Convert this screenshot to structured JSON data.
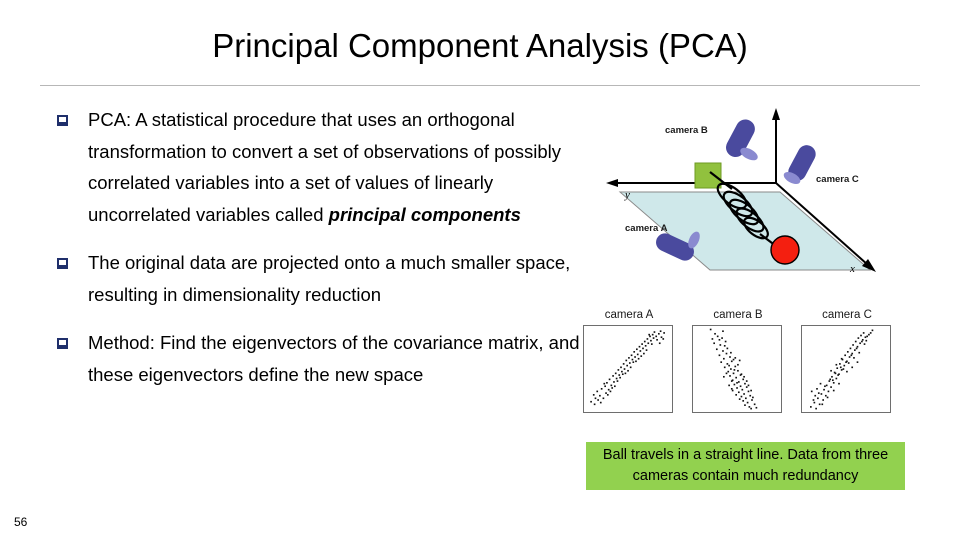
{
  "slide": {
    "title": "Principal Component Analysis (PCA)",
    "page_number": "56"
  },
  "bullets": [
    {
      "marker": "❑",
      "text_before": "PCA:  A statistical procedure that uses an orthogonal transformation to convert a set of observations of possibly correlated variables into a set of values of linearly uncorrelated variables called ",
      "emphasis": "principal components",
      "text_after": ""
    },
    {
      "marker": "❑",
      "text_before": "The original data are projected onto a much smaller space, resulting in dimensionality reduction",
      "emphasis": "",
      "text_after": ""
    },
    {
      "marker": "❑",
      "text_before": "Method:  Find the eigenvectors of the covariance matrix, and these eigenvectors define the new space",
      "emphasis": "",
      "text_after": ""
    }
  ],
  "figure_3d": {
    "axis_x_label": "x",
    "axis_y_label": "y",
    "camera_a_label": "camera A",
    "camera_b_label": "camera B",
    "camera_c_label": "camera C",
    "colors": {
      "plane": "#cfe8ea",
      "plane_edge": "#808080",
      "camera_body": "#4a4a9e",
      "camera_lens": "#8a8ad0",
      "wall_mount": "#91c13e",
      "ball": "#f41f10",
      "spring": "#000000",
      "axis": "#000000"
    }
  },
  "camera_panels": [
    {
      "label": "camera A",
      "chart_data": {
        "type": "scatter",
        "title": "camera A",
        "xlabel": "",
        "ylabel": "",
        "xlim": [
          0,
          100
        ],
        "ylim": [
          0,
          100
        ],
        "grid": false,
        "points": [
          [
            8,
            12
          ],
          [
            12,
            9
          ],
          [
            16,
            14
          ],
          [
            11,
            20
          ],
          [
            18,
            19
          ],
          [
            22,
            16
          ],
          [
            15,
            24
          ],
          [
            20,
            27
          ],
          [
            25,
            22
          ],
          [
            24,
            30
          ],
          [
            28,
            26
          ],
          [
            26,
            34
          ],
          [
            31,
            31
          ],
          [
            29,
            38
          ],
          [
            34,
            35
          ],
          [
            33,
            42
          ],
          [
            37,
            39
          ],
          [
            36,
            45
          ],
          [
            40,
            43
          ],
          [
            39,
            49
          ],
          [
            43,
            47
          ],
          [
            42,
            52
          ],
          [
            46,
            50
          ],
          [
            45,
            56
          ],
          [
            49,
            54
          ],
          [
            48,
            60
          ],
          [
            52,
            57
          ],
          [
            51,
            63
          ],
          [
            55,
            61
          ],
          [
            54,
            66
          ],
          [
            58,
            64
          ],
          [
            57,
            70
          ],
          [
            61,
            67
          ],
          [
            60,
            73
          ],
          [
            64,
            71
          ],
          [
            63,
            76
          ],
          [
            67,
            74
          ],
          [
            66,
            79
          ],
          [
            70,
            77
          ],
          [
            69,
            82
          ],
          [
            73,
            80
          ],
          [
            72,
            85
          ],
          [
            76,
            83
          ],
          [
            75,
            88
          ],
          [
            79,
            86
          ],
          [
            78,
            90
          ],
          [
            82,
            88
          ],
          [
            85,
            91
          ],
          [
            88,
            87
          ],
          [
            91,
            92
          ],
          [
            38,
            36
          ],
          [
            44,
            44
          ],
          [
            50,
            48
          ],
          [
            56,
            58
          ],
          [
            62,
            62
          ],
          [
            68,
            68
          ],
          [
            30,
            24
          ],
          [
            35,
            30
          ],
          [
            41,
            40
          ],
          [
            47,
            45
          ],
          [
            53,
            52
          ],
          [
            59,
            59
          ],
          [
            65,
            65
          ],
          [
            71,
            72
          ],
          [
            77,
            79
          ],
          [
            83,
            84
          ],
          [
            86,
            80
          ],
          [
            13,
            16
          ],
          [
            19,
            11
          ],
          [
            23,
            33
          ],
          [
            27,
            20
          ],
          [
            32,
            28
          ],
          [
            80,
            93
          ],
          [
            74,
            90
          ],
          [
            87,
            94
          ],
          [
            90,
            85
          ]
        ]
      }
    },
    {
      "label": "camera B",
      "chart_data": {
        "type": "scatter",
        "title": "camera B",
        "xlabel": "",
        "ylabel": "",
        "xlim": [
          0,
          100
        ],
        "ylim": [
          0,
          100
        ],
        "grid": false,
        "points": [
          [
            20,
            96
          ],
          [
            28,
            88
          ],
          [
            33,
            86
          ],
          [
            24,
            80
          ],
          [
            31,
            78
          ],
          [
            37,
            82
          ],
          [
            27,
            73
          ],
          [
            34,
            71
          ],
          [
            30,
            66
          ],
          [
            38,
            68
          ],
          [
            35,
            62
          ],
          [
            42,
            64
          ],
          [
            32,
            58
          ],
          [
            39,
            56
          ],
          [
            44,
            59
          ],
          [
            36,
            52
          ],
          [
            43,
            50
          ],
          [
            48,
            53
          ],
          [
            40,
            47
          ],
          [
            46,
            45
          ],
          [
            51,
            48
          ],
          [
            42,
            42
          ],
          [
            49,
            40
          ],
          [
            54,
            43
          ],
          [
            45,
            37
          ],
          [
            52,
            35
          ],
          [
            57,
            38
          ],
          [
            47,
            32
          ],
          [
            54,
            30
          ],
          [
            59,
            33
          ],
          [
            50,
            28
          ],
          [
            56,
            26
          ],
          [
            61,
            29
          ],
          [
            52,
            23
          ],
          [
            58,
            21
          ],
          [
            63,
            24
          ],
          [
            55,
            18
          ],
          [
            60,
            16
          ],
          [
            65,
            19
          ],
          [
            57,
            13
          ],
          [
            62,
            11
          ],
          [
            67,
            14
          ],
          [
            59,
            8
          ],
          [
            64,
            6
          ],
          [
            70,
            9
          ],
          [
            66,
            4
          ],
          [
            72,
            5
          ],
          [
            41,
            54
          ],
          [
            47,
            49
          ],
          [
            44,
            36
          ],
          [
            50,
            34
          ],
          [
            53,
            60
          ],
          [
            46,
            61
          ],
          [
            39,
            74
          ],
          [
            36,
            77
          ],
          [
            43,
            69
          ],
          [
            48,
            63
          ],
          [
            51,
            55
          ],
          [
            55,
            44
          ],
          [
            58,
            41
          ],
          [
            61,
            36
          ],
          [
            63,
            31
          ],
          [
            66,
            25
          ],
          [
            68,
            17
          ],
          [
            45,
            25
          ],
          [
            49,
            20
          ],
          [
            53,
            15
          ],
          [
            38,
            45
          ],
          [
            35,
            41
          ],
          [
            41,
            31
          ],
          [
            44,
            27
          ],
          [
            30,
            84
          ],
          [
            25,
            91
          ],
          [
            22,
            85
          ],
          [
            34,
            94
          ]
        ]
      }
    },
    {
      "label": "camera C",
      "chart_data": {
        "type": "scatter",
        "title": "camera C",
        "xlabel": "",
        "ylabel": "",
        "xlim": [
          0,
          100
        ],
        "ylim": [
          0,
          100
        ],
        "grid": false,
        "points": [
          [
            10,
            6
          ],
          [
            16,
            4
          ],
          [
            14,
            11
          ],
          [
            20,
            9
          ],
          [
            18,
            16
          ],
          [
            24,
            14
          ],
          [
            22,
            21
          ],
          [
            27,
            19
          ],
          [
            25,
            26
          ],
          [
            30,
            24
          ],
          [
            28,
            31
          ],
          [
            33,
            29
          ],
          [
            31,
            36
          ],
          [
            36,
            34
          ],
          [
            34,
            41
          ],
          [
            39,
            39
          ],
          [
            37,
            46
          ],
          [
            42,
            44
          ],
          [
            40,
            51
          ],
          [
            45,
            49
          ],
          [
            43,
            56
          ],
          [
            48,
            54
          ],
          [
            46,
            61
          ],
          [
            51,
            59
          ],
          [
            49,
            66
          ],
          [
            54,
            64
          ],
          [
            52,
            70
          ],
          [
            57,
            68
          ],
          [
            55,
            74
          ],
          [
            60,
            72
          ],
          [
            58,
            78
          ],
          [
            63,
            76
          ],
          [
            61,
            82
          ],
          [
            66,
            80
          ],
          [
            64,
            86
          ],
          [
            69,
            84
          ],
          [
            67,
            89
          ],
          [
            72,
            87
          ],
          [
            70,
            92
          ],
          [
            76,
            90
          ],
          [
            80,
            95
          ],
          [
            35,
            37
          ],
          [
            41,
            43
          ],
          [
            47,
            50
          ],
          [
            53,
            57
          ],
          [
            59,
            63
          ],
          [
            65,
            69
          ],
          [
            71,
            79
          ],
          [
            13,
            14
          ],
          [
            19,
            22
          ],
          [
            26,
            30
          ],
          [
            32,
            38
          ],
          [
            38,
            45
          ],
          [
            44,
            52
          ],
          [
            50,
            58
          ],
          [
            56,
            66
          ],
          [
            62,
            74
          ],
          [
            68,
            82
          ],
          [
            74,
            88
          ],
          [
            29,
            17
          ],
          [
            23,
            9
          ],
          [
            17,
            27
          ],
          [
            21,
            33
          ],
          [
            36,
            25
          ],
          [
            42,
            33
          ],
          [
            15,
            19
          ],
          [
            11,
            24
          ],
          [
            33,
            48
          ],
          [
            39,
            55
          ],
          [
            45,
            62
          ],
          [
            51,
            47
          ],
          [
            57,
            52
          ],
          [
            63,
            58
          ],
          [
            73,
            83
          ],
          [
            78,
            92
          ]
        ]
      }
    }
  ],
  "caption": {
    "line1": "Ball travels in a straight line. Data from",
    "line2": "three cameras contain much redundancy",
    "background": "#92d14f"
  }
}
